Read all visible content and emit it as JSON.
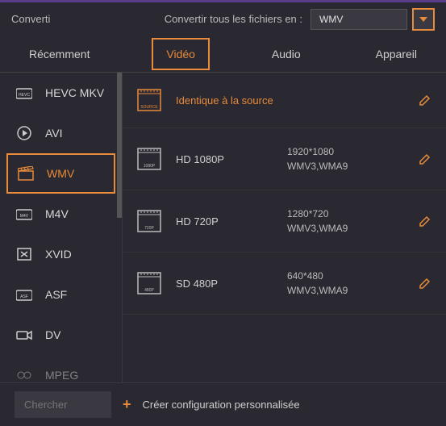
{
  "topbar": {
    "tab": "Converti",
    "convert_label": "Convertir tous les fichiers en :",
    "selected_format": "WMV"
  },
  "tabs": {
    "recent": "Récemment",
    "video": "Vidéo",
    "audio": "Audio",
    "device": "Appareil"
  },
  "sidebar": {
    "items": [
      {
        "label": "HEVC MKV"
      },
      {
        "label": "AVI"
      },
      {
        "label": "WMV"
      },
      {
        "label": "M4V"
      },
      {
        "label": "XVID"
      },
      {
        "label": "ASF"
      },
      {
        "label": "DV"
      },
      {
        "label": "MPEG"
      }
    ]
  },
  "presets": [
    {
      "name": "Identique à la source",
      "res": "",
      "codecs": "",
      "source": true,
      "icon_label": "SOURCE"
    },
    {
      "name": "HD 1080P",
      "res": "1920*1080",
      "codecs": "WMV3,WMA9",
      "icon_label": "1080P"
    },
    {
      "name": "HD 720P",
      "res": "1280*720",
      "codecs": "WMV3,WMA9",
      "icon_label": "720P"
    },
    {
      "name": "SD 480P",
      "res": "640*480",
      "codecs": "WMV3,WMA9",
      "icon_label": "480P"
    }
  ],
  "bottom": {
    "search_placeholder": "Chercher",
    "create_label": "Créer configuration personnalisée"
  }
}
